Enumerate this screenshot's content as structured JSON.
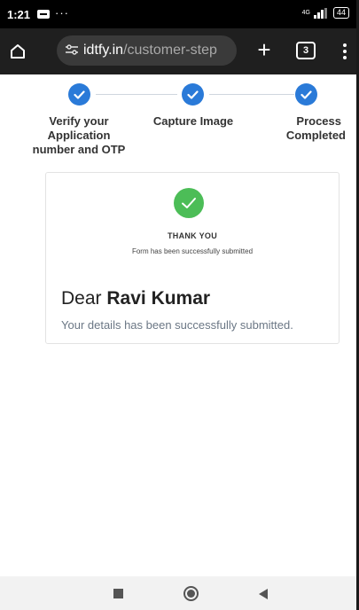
{
  "status_bar": {
    "time": "1:21",
    "dots": "···",
    "network": "4G",
    "battery": "44"
  },
  "browser": {
    "url_domain": "idtfy.in",
    "url_path": "/customer-step",
    "tab_count": "3",
    "new_tab_symbol": "+"
  },
  "stepper": {
    "steps": [
      {
        "label_line1": "Verify your",
        "label_line2": "Application",
        "label_line3": "number and OTP",
        "completed": true
      },
      {
        "label_line1": "Capture Image",
        "completed": true
      },
      {
        "label_line1": "Process",
        "label_line2": "Completed",
        "completed": true
      }
    ]
  },
  "card": {
    "thank_you": "THANK YOU",
    "form_note": "Form has been successfully submitted",
    "greeting": "Dear",
    "name": "Ravi Kumar",
    "details": "Your details has been successfully submitted."
  },
  "colors": {
    "step_blue": "#2a7ad8",
    "success_green": "#4cbd57"
  },
  "icons": {
    "home": "home-icon",
    "tune": "tune-icon",
    "check": "check-icon",
    "menu": "more-vert-icon"
  }
}
